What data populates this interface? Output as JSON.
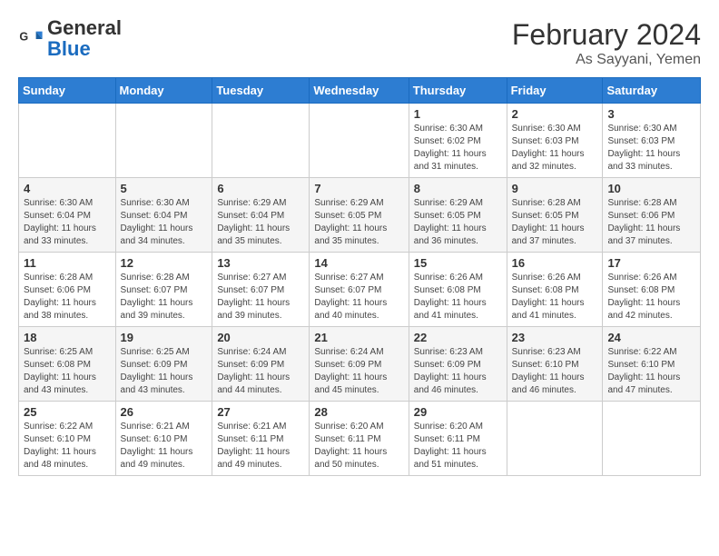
{
  "header": {
    "logo_general": "General",
    "logo_blue": "Blue",
    "month": "February 2024",
    "location": "As Sayyani, Yemen"
  },
  "weekdays": [
    "Sunday",
    "Monday",
    "Tuesday",
    "Wednesday",
    "Thursday",
    "Friday",
    "Saturday"
  ],
  "weeks": [
    [
      {
        "day": "",
        "info": ""
      },
      {
        "day": "",
        "info": ""
      },
      {
        "day": "",
        "info": ""
      },
      {
        "day": "",
        "info": ""
      },
      {
        "day": "1",
        "info": "Sunrise: 6:30 AM\nSunset: 6:02 PM\nDaylight: 11 hours and 31 minutes."
      },
      {
        "day": "2",
        "info": "Sunrise: 6:30 AM\nSunset: 6:03 PM\nDaylight: 11 hours and 32 minutes."
      },
      {
        "day": "3",
        "info": "Sunrise: 6:30 AM\nSunset: 6:03 PM\nDaylight: 11 hours and 33 minutes."
      }
    ],
    [
      {
        "day": "4",
        "info": "Sunrise: 6:30 AM\nSunset: 6:04 PM\nDaylight: 11 hours and 33 minutes."
      },
      {
        "day": "5",
        "info": "Sunrise: 6:30 AM\nSunset: 6:04 PM\nDaylight: 11 hours and 34 minutes."
      },
      {
        "day": "6",
        "info": "Sunrise: 6:29 AM\nSunset: 6:04 PM\nDaylight: 11 hours and 35 minutes."
      },
      {
        "day": "7",
        "info": "Sunrise: 6:29 AM\nSunset: 6:05 PM\nDaylight: 11 hours and 35 minutes."
      },
      {
        "day": "8",
        "info": "Sunrise: 6:29 AM\nSunset: 6:05 PM\nDaylight: 11 hours and 36 minutes."
      },
      {
        "day": "9",
        "info": "Sunrise: 6:28 AM\nSunset: 6:05 PM\nDaylight: 11 hours and 37 minutes."
      },
      {
        "day": "10",
        "info": "Sunrise: 6:28 AM\nSunset: 6:06 PM\nDaylight: 11 hours and 37 minutes."
      }
    ],
    [
      {
        "day": "11",
        "info": "Sunrise: 6:28 AM\nSunset: 6:06 PM\nDaylight: 11 hours and 38 minutes."
      },
      {
        "day": "12",
        "info": "Sunrise: 6:28 AM\nSunset: 6:07 PM\nDaylight: 11 hours and 39 minutes."
      },
      {
        "day": "13",
        "info": "Sunrise: 6:27 AM\nSunset: 6:07 PM\nDaylight: 11 hours and 39 minutes."
      },
      {
        "day": "14",
        "info": "Sunrise: 6:27 AM\nSunset: 6:07 PM\nDaylight: 11 hours and 40 minutes."
      },
      {
        "day": "15",
        "info": "Sunrise: 6:26 AM\nSunset: 6:08 PM\nDaylight: 11 hours and 41 minutes."
      },
      {
        "day": "16",
        "info": "Sunrise: 6:26 AM\nSunset: 6:08 PM\nDaylight: 11 hours and 41 minutes."
      },
      {
        "day": "17",
        "info": "Sunrise: 6:26 AM\nSunset: 6:08 PM\nDaylight: 11 hours and 42 minutes."
      }
    ],
    [
      {
        "day": "18",
        "info": "Sunrise: 6:25 AM\nSunset: 6:08 PM\nDaylight: 11 hours and 43 minutes."
      },
      {
        "day": "19",
        "info": "Sunrise: 6:25 AM\nSunset: 6:09 PM\nDaylight: 11 hours and 43 minutes."
      },
      {
        "day": "20",
        "info": "Sunrise: 6:24 AM\nSunset: 6:09 PM\nDaylight: 11 hours and 44 minutes."
      },
      {
        "day": "21",
        "info": "Sunrise: 6:24 AM\nSunset: 6:09 PM\nDaylight: 11 hours and 45 minutes."
      },
      {
        "day": "22",
        "info": "Sunrise: 6:23 AM\nSunset: 6:09 PM\nDaylight: 11 hours and 46 minutes."
      },
      {
        "day": "23",
        "info": "Sunrise: 6:23 AM\nSunset: 6:10 PM\nDaylight: 11 hours and 46 minutes."
      },
      {
        "day": "24",
        "info": "Sunrise: 6:22 AM\nSunset: 6:10 PM\nDaylight: 11 hours and 47 minutes."
      }
    ],
    [
      {
        "day": "25",
        "info": "Sunrise: 6:22 AM\nSunset: 6:10 PM\nDaylight: 11 hours and 48 minutes."
      },
      {
        "day": "26",
        "info": "Sunrise: 6:21 AM\nSunset: 6:10 PM\nDaylight: 11 hours and 49 minutes."
      },
      {
        "day": "27",
        "info": "Sunrise: 6:21 AM\nSunset: 6:11 PM\nDaylight: 11 hours and 49 minutes."
      },
      {
        "day": "28",
        "info": "Sunrise: 6:20 AM\nSunset: 6:11 PM\nDaylight: 11 hours and 50 minutes."
      },
      {
        "day": "29",
        "info": "Sunrise: 6:20 AM\nSunset: 6:11 PM\nDaylight: 11 hours and 51 minutes."
      },
      {
        "day": "",
        "info": ""
      },
      {
        "day": "",
        "info": ""
      }
    ]
  ]
}
